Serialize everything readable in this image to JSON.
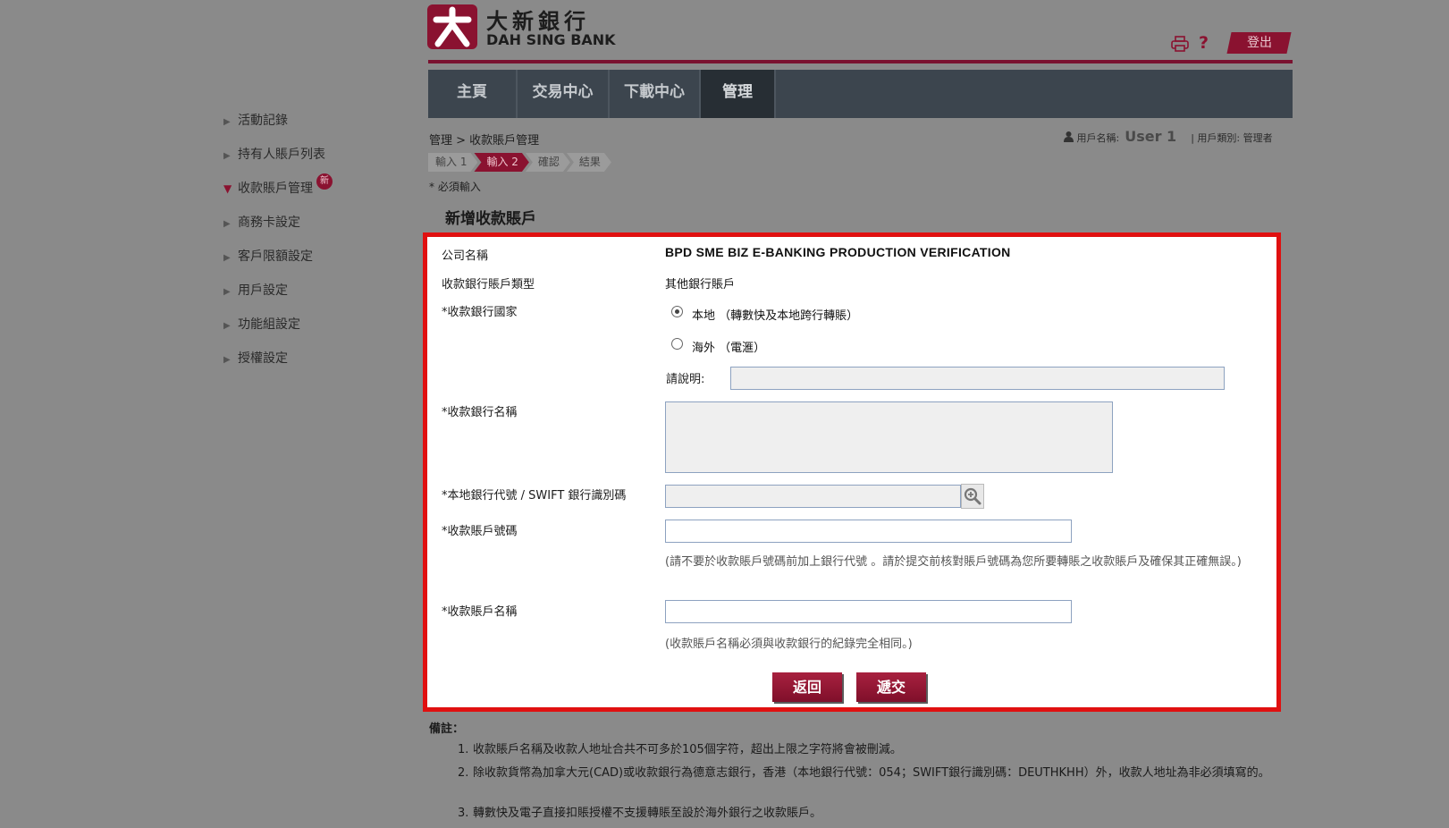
{
  "brand": {
    "name_zh": "大新銀行",
    "name_en": "DAH SING BANK"
  },
  "header": {
    "help": "?",
    "logout": "登出"
  },
  "nav": [
    "主頁",
    "交易中心",
    "下載中心",
    "管理"
  ],
  "sidebar": [
    {
      "label": "活動記錄"
    },
    {
      "label": "持有人賬戶列表"
    },
    {
      "label": "收款賬戶管理",
      "badge": "新"
    },
    {
      "label": "商務卡設定"
    },
    {
      "label": "客戶限額設定"
    },
    {
      "label": "用戶設定"
    },
    {
      "label": "功能組設定"
    },
    {
      "label": "授權設定"
    }
  ],
  "breadcrumb": "管理 > 收款賬戶管理",
  "user": {
    "name_label": "用戶名稱:",
    "name": "User 1",
    "type_label": "| 用戶類別: 管理者"
  },
  "steps": [
    "輸入 1",
    "輸入 2",
    "確認",
    "結果"
  ],
  "required_note": "* 必須輸入",
  "section_title": "新增收款賬戶",
  "form": {
    "company_label": "公司名稱",
    "company_value": "BPD SME BIZ E-BANKING PRODUCTION VERIFICATION",
    "acct_type_label": "收款銀行賬戶類型",
    "acct_type_value": "其他銀行賬戶",
    "country_label": "*收款銀行國家",
    "radio_local": "本地 （轉數快及本地跨行轉賬）",
    "radio_overseas": "海外 （電滙）",
    "explain_label": "請說明:",
    "bank_name_label": "*收款銀行名稱",
    "bank_code_label": "*本地銀行代號 / SWIFT 銀行識別碼",
    "acct_no_label": "*收款賬戶號碼",
    "acct_no_hint": "(請不要於收款賬戶號碼前加上銀行代號 。請於提交前核對賬戶號碼為您所要轉賬之收款賬戶及確保其正確無誤。)",
    "acct_name_label": "*收款賬戶名稱",
    "acct_name_hint": "(收款賬戶名稱必須與收款銀行的紀錄完全相同。)",
    "back": "返回",
    "submit": "遞交"
  },
  "remarks": {
    "title": "備註：",
    "items": [
      "收款賬戶名稱及收款人地址合共不可多於105個字符，超出上限之字符將會被刪減。",
      "除收款貨幣為加拿大元(CAD)或收款銀行為德意志銀行，香港（本地銀行代號：054；SWIFT銀行識別碼：DEUTHKHH）外，收款人地址為非必須填寫的。",
      "轉數快及電子直接扣賬授權不支援轉賬至設於海外銀行之收款賬戶。"
    ]
  },
  "colors": {
    "brand": "#8a1230",
    "nav_bg": "#3c454e",
    "highlight_border": "#e01010"
  }
}
